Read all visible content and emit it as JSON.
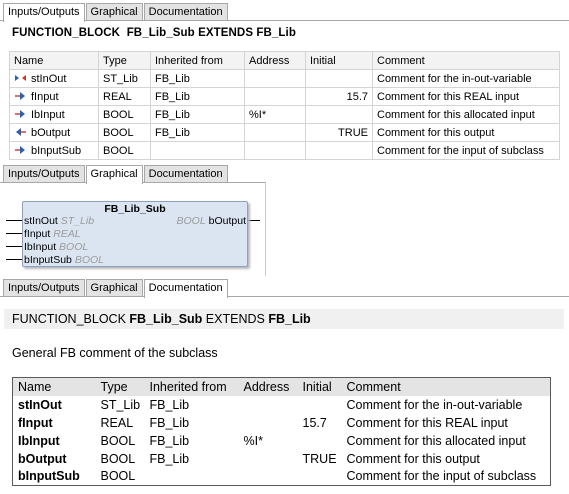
{
  "io_section": {
    "tabs": [
      "Inputs/Outputs",
      "Graphical",
      "Documentation"
    ],
    "header": {
      "keyword": "FUNCTION_BLOCK",
      "name": "FB_Lib_Sub",
      "extends_keyword": "EXTENDS",
      "base": "FB_Lib"
    },
    "columns": [
      "Name",
      "Type",
      "Inherited from",
      "Address",
      "Initial",
      "Comment"
    ],
    "rows": [
      {
        "icon": "in-out-variable-icon",
        "name": "stInOut",
        "type": "ST_Lib",
        "inherited": "FB_Lib",
        "address": "",
        "initial": "",
        "comment": "Comment for the in-out-variable"
      },
      {
        "icon": "input-variable-icon",
        "name": "fInput",
        "type": "REAL",
        "inherited": "FB_Lib",
        "address": "",
        "initial": "15.7",
        "comment": "Comment for this REAL input"
      },
      {
        "icon": "input-variable-icon",
        "name": "IbInput",
        "type": "BOOL",
        "inherited": "FB_Lib",
        "address": "%I*",
        "initial": "",
        "comment": "Comment for this allocated input"
      },
      {
        "icon": "output-variable-icon",
        "name": "bOutput",
        "type": "BOOL",
        "inherited": "FB_Lib",
        "address": "",
        "initial": "TRUE",
        "comment": "Comment for this output"
      },
      {
        "icon": "input-variable-icon",
        "name": "bInputSub",
        "type": "BOOL",
        "inherited": "",
        "address": "",
        "initial": "",
        "comment": "Comment for the input of subclass"
      }
    ]
  },
  "graphical_section": {
    "tabs": [
      "Inputs/Outputs",
      "Graphical",
      "Documentation"
    ],
    "block_name": "FB_Lib_Sub",
    "inputs": [
      {
        "name": "stInOut",
        "type": "ST_Lib"
      },
      {
        "name": "fInput",
        "type": "REAL"
      },
      {
        "name": "IbInput",
        "type": "BOOL"
      },
      {
        "name": "bInputSub",
        "type": "BOOL"
      }
    ],
    "outputs": [
      {
        "name": "bOutput",
        "type": "BOOL"
      }
    ]
  },
  "doc_section": {
    "tabs": [
      "Inputs/Outputs",
      "Graphical",
      "Documentation"
    ],
    "header": {
      "keyword": "FUNCTION_BLOCK",
      "name": "FB_Lib_Sub",
      "extends_keyword": "EXTENDS",
      "base": "FB_Lib"
    },
    "comment": "General FB comment of the subclass",
    "columns": [
      "Name",
      "Type",
      "Inherited from",
      "Address",
      "Initial",
      "Comment"
    ],
    "rows": [
      {
        "name": "stInOut",
        "type": "ST_Lib",
        "inherited": "FB_Lib",
        "address": "",
        "initial": "",
        "comment": "Comment for the in-out-variable"
      },
      {
        "name": "fInput",
        "type": "REAL",
        "inherited": "FB_Lib",
        "address": "",
        "initial": "15.7",
        "comment": "Comment for this REAL input"
      },
      {
        "name": "IbInput",
        "type": "BOOL",
        "inherited": "FB_Lib",
        "address": "%I*",
        "initial": "",
        "comment": "Comment for this allocated input"
      },
      {
        "name": "bOutput",
        "type": "BOOL",
        "inherited": "FB_Lib",
        "address": "",
        "initial": "TRUE",
        "comment": "Comment for this output"
      },
      {
        "name": "bInputSub",
        "type": "BOOL",
        "inherited": "",
        "address": "",
        "initial": "",
        "comment": "Comment for the input of subclass"
      }
    ]
  },
  "colors": {
    "block_fill": "#dbe5f1",
    "block_border": "#8ea2bf",
    "type_hint": "#9a9a9a",
    "tab_inactive": "#e3e3e3"
  }
}
